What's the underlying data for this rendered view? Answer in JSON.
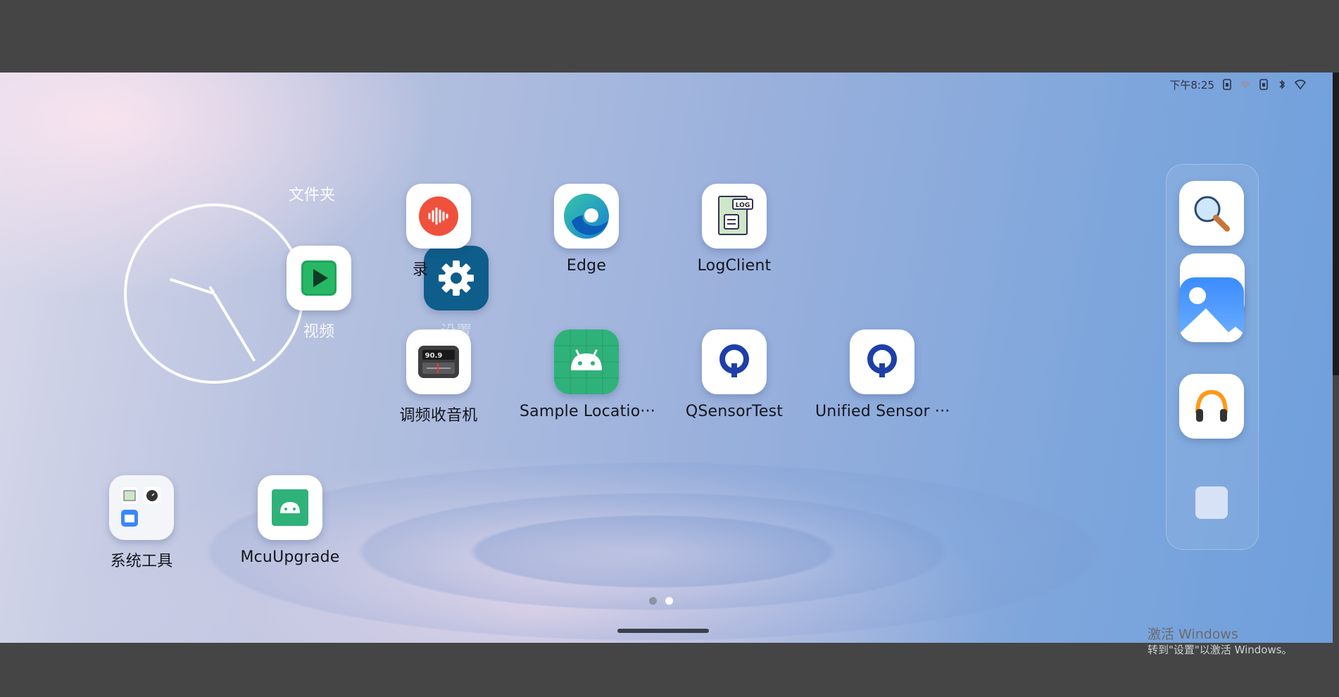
{
  "status_bar": {
    "time": "下午8:25"
  },
  "folder": {
    "title": "文件夹",
    "apps": [
      {
        "label": "视频"
      },
      {
        "label": "设置"
      }
    ]
  },
  "apps": [
    {
      "label": "录"
    },
    {
      "label": "Edge"
    },
    {
      "label": "LogClient"
    },
    {
      "label": "调频收音机",
      "readout": "90.9"
    },
    {
      "label": "Sample Locatio···"
    },
    {
      "label": "QSensorTest"
    },
    {
      "label": "Unified Sensor ···"
    },
    {
      "label": "系统工具"
    },
    {
      "label": "McuUpgrade"
    }
  ],
  "log_badge": "LOG",
  "dock": [
    {
      "name": "search"
    },
    {
      "name": "gallery"
    },
    {
      "name": "music"
    },
    {
      "name": "placeholder"
    }
  ],
  "page_indicator": {
    "pages": 2,
    "active": 2
  },
  "colors": {
    "accent_red": "#f0513d",
    "settings_blue": "#0e5d8a",
    "android_green": "#2fb27a",
    "qualcomm_blue": "#1d3fa8"
  },
  "watermark": {
    "line1": "激活 Windows",
    "line2": "转到\"设置\"以激活 Windows。"
  }
}
